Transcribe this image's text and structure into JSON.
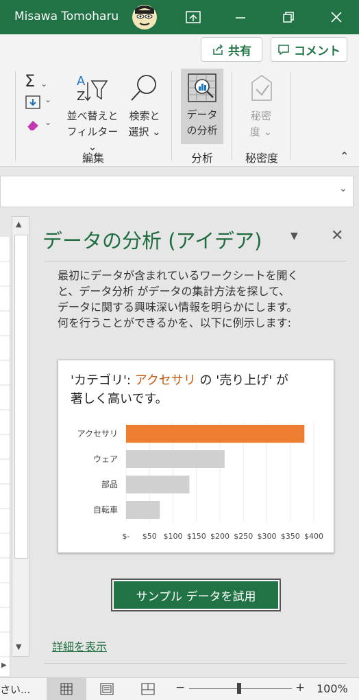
{
  "titlebar": {
    "user": "Misawa Tomoharu",
    "bg": "#217346"
  },
  "share": {
    "share_label": "共有",
    "comment_label": "コメント"
  },
  "ribbon": {
    "sort_filter_line1": "並べ替えと",
    "sort_filter_line2": "フィルター",
    "find_line1": "検索と",
    "find_line2": "選択",
    "analyze_line1": "データ",
    "analyze_line2": "の分析",
    "sens_line1": "秘密",
    "sens_line2": "度",
    "group_edit": "編集",
    "group_analysis": "分析",
    "group_sensitivity": "秘密度"
  },
  "pane": {
    "title": "データの分析 (アイデア)",
    "desc_lines": [
      "最初にデータが含まれているワークシートを開く",
      "と、データ分析 がデータの集計方法を探して、",
      "データに関する興味深い情報を明らかにします。",
      "何を行うことができるかを、以下に例示します:"
    ],
    "card_title_part1": "'カテゴリ': ",
    "card_title_highlight": "アクセサリ",
    "card_title_part2": " の '売り上げ' が",
    "card_title_line2": "著しく高いです。",
    "try_button": "サンプル データを試用",
    "details_link": "詳細を表示"
  },
  "chart_data": {
    "type": "bar",
    "orientation": "horizontal",
    "categories": [
      "アクセサリ",
      "ウェア",
      "部品",
      "自転車"
    ],
    "values": [
      380,
      210,
      135,
      72
    ],
    "highlight_color": "#ed7d31",
    "bar_color": "#d0d0d0",
    "xlim": [
      0,
      400
    ],
    "xticks": [
      "$-",
      "$50",
      "$100",
      "$150",
      "$200",
      "$250",
      "$300",
      "$350",
      "$400"
    ],
    "grid": true
  },
  "status": {
    "left_text": "さい...",
    "zoom": "100%"
  }
}
